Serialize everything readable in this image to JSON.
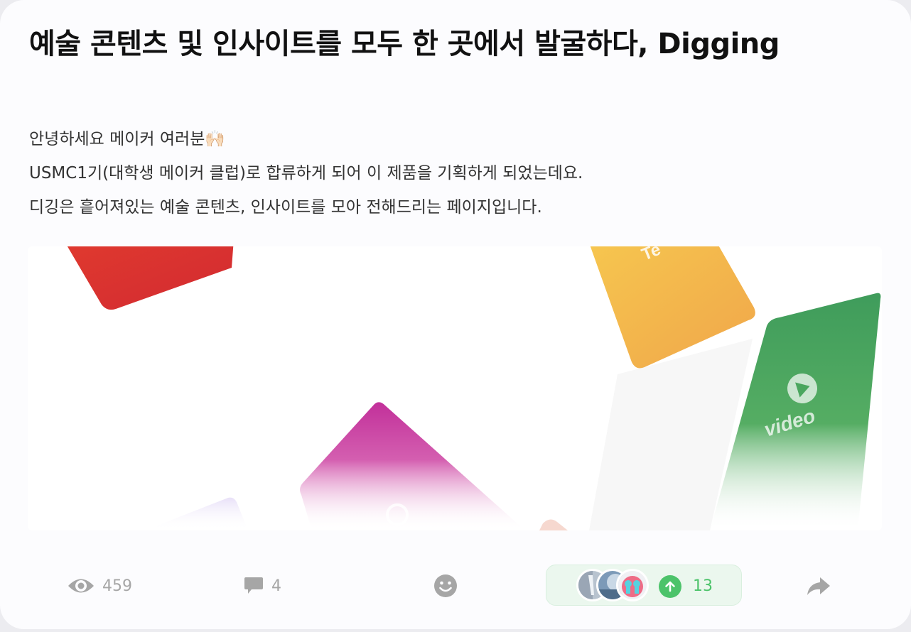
{
  "post": {
    "title": "예술 콘텐츠 및 인사이트를 모두 한 곳에서 발굴하다, Digging",
    "description": [
      "안녕하세요 메이커 여러분🙌🏻",
      "USMC1기(대학생 메이커 클럽)로 합류하게 되어 이 제품을 기획하게 되었는데요.",
      "디깅은 흩어져있는 예술 콘텐츠, 인사이트를 모아 전해드리는 페이지입니다."
    ],
    "hero": {
      "card_labels": [
        "video"
      ],
      "colors": {
        "red": "#d92f2f",
        "yellow": "#f2b44a",
        "green": "#43a05a",
        "magenta": "#c2309a"
      }
    }
  },
  "stats": {
    "views": "459",
    "comments": "4",
    "upvotes": "13"
  },
  "icons": {
    "views": "eye-icon",
    "comments": "comment-icon",
    "reaction": "emoji-icon",
    "upvote": "arrow-up-icon",
    "share": "share-icon"
  },
  "theme": {
    "accent_green": "#4cc36a",
    "muted_gray": "#a6a6a6"
  }
}
